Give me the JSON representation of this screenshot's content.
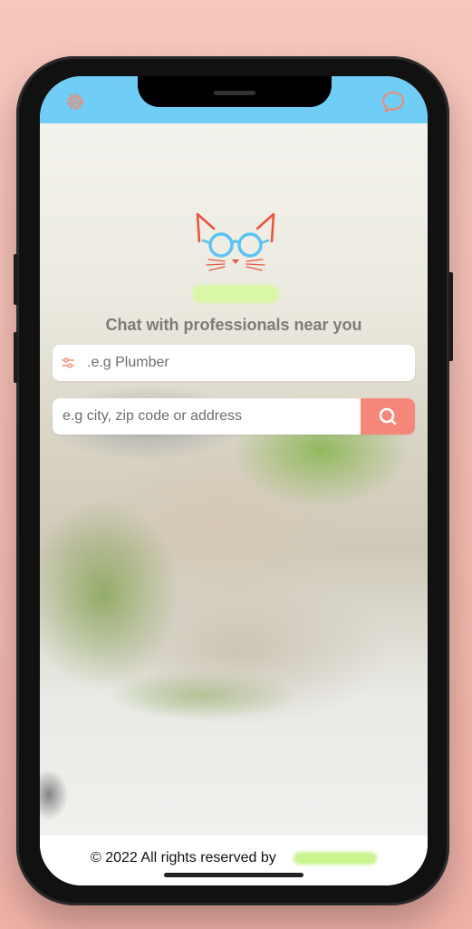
{
  "header": {
    "settings_icon": "gear-icon",
    "chat_icon": "chat-bubble-icon",
    "accent_color": "#6fcdf6"
  },
  "hero": {
    "logo_icon": "cat-with-glasses-logo",
    "tagline": "Chat with professionals near you"
  },
  "search": {
    "service_placeholder": ".e.g Plumber",
    "location_placeholder": "e.g city, zip code or address",
    "filter_icon": "sliders-icon",
    "search_icon": "search-icon",
    "button_color": "#f5877a"
  },
  "footer": {
    "copyright": "© 2022 All rights reserved by"
  }
}
